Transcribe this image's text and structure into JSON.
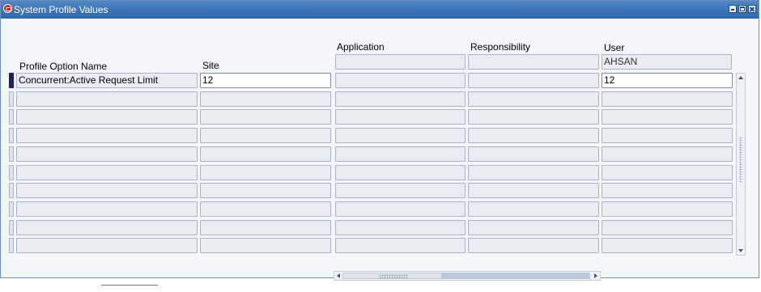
{
  "window": {
    "title": "System Profile Values",
    "icon": "oracle-icon",
    "controls": [
      "minimize-icon",
      "maximize-icon",
      "close-icon"
    ]
  },
  "columns": {
    "profile_option_name": "Profile Option Name",
    "site": "Site",
    "application": "Application",
    "responsibility": "Responsibility",
    "user": "User"
  },
  "context": {
    "application": "",
    "responsibility": "",
    "user": "AHSAN"
  },
  "rows": [
    {
      "profile_option": "Concurrent:Active Request Limit",
      "site": "12",
      "application": "",
      "responsibility": "",
      "user": "12"
    },
    {
      "profile_option": "",
      "site": "",
      "application": "",
      "responsibility": "",
      "user": ""
    },
    {
      "profile_option": "",
      "site": "",
      "application": "",
      "responsibility": "",
      "user": ""
    },
    {
      "profile_option": "",
      "site": "",
      "application": "",
      "responsibility": "",
      "user": ""
    },
    {
      "profile_option": "",
      "site": "",
      "application": "",
      "responsibility": "",
      "user": ""
    },
    {
      "profile_option": "",
      "site": "",
      "application": "",
      "responsibility": "",
      "user": ""
    },
    {
      "profile_option": "",
      "site": "",
      "application": "",
      "responsibility": "",
      "user": ""
    },
    {
      "profile_option": "",
      "site": "",
      "application": "",
      "responsibility": "",
      "user": ""
    },
    {
      "profile_option": "",
      "site": "",
      "application": "",
      "responsibility": "",
      "user": ""
    },
    {
      "profile_option": "",
      "site": "",
      "application": "",
      "responsibility": "",
      "user": ""
    }
  ],
  "colors": {
    "titlebar": "#2f66aa",
    "current_row_indicator": "#1a1f6e",
    "field_background": "#e9edf2"
  }
}
